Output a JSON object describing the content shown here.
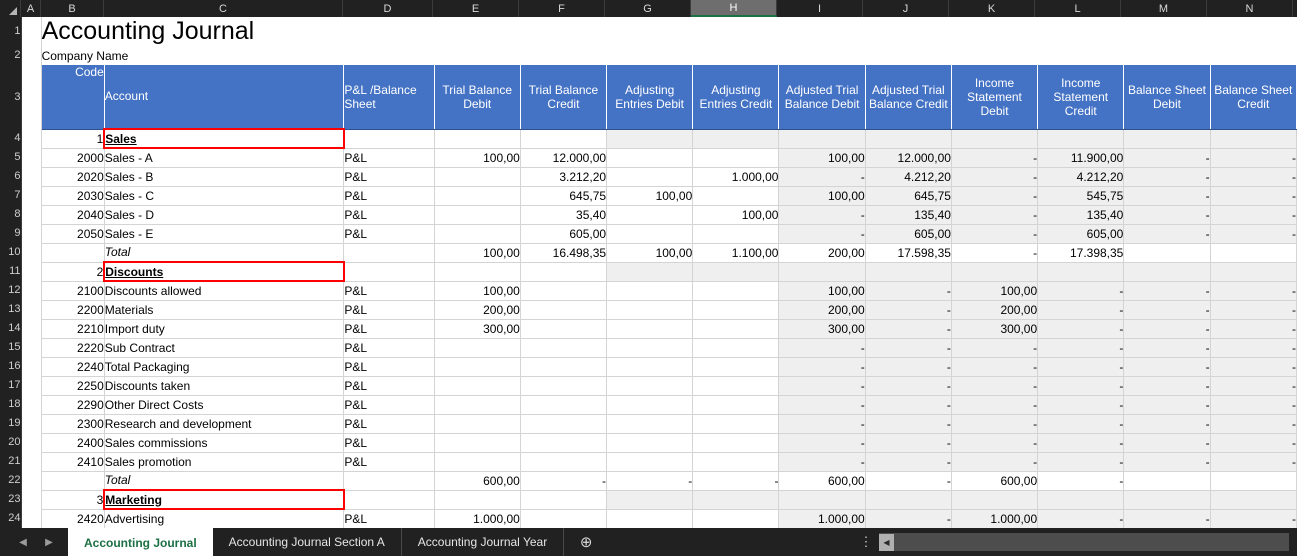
{
  "window": {
    "column_headers": [
      "A",
      "B",
      "C",
      "D",
      "E",
      "F",
      "G",
      "H",
      "I",
      "J",
      "K",
      "L",
      "M",
      "N"
    ],
    "selected_column": "H"
  },
  "document": {
    "title": "Accounting Journal",
    "subtitle": "Company Name"
  },
  "table": {
    "headers": {
      "code": "Code",
      "account": "Account",
      "pl_balance_sheet": "P&L /Balance Sheet",
      "trial_balance_debit": "Trial Balance Debit",
      "trial_balance_credit": "Trial Balance Credit",
      "adjusting_entries_debit": "Adjusting Entries Debit",
      "adjusting_entries_credit": "Adjusting Entries Credit",
      "adjusted_trial_balance_debit": "Adjusted Trial Balance Debit",
      "adjusted_trial_balance_credit": "Adjusted Trial Balance Credit",
      "income_statement_debit": "Income Statement Debit",
      "income_statement_credit": "Income Statement Credit",
      "balance_sheet_debit": "Balance Sheet Debit",
      "balance_sheet_credit": "Balance Sheet Credit"
    },
    "total_label": "Total",
    "rows": [
      {
        "rownum": "4",
        "kind": "section",
        "code": "1",
        "account": "Sales"
      },
      {
        "rownum": "5",
        "kind": "data",
        "code": "2000",
        "account": "Sales - A",
        "pl": "P&L",
        "tbd": "100,00",
        "tbc": "12.000,00",
        "aed": "",
        "aec": "",
        "atbd": "100,00",
        "atbc": "12.000,00",
        "isd": "-",
        "isc": "11.900,00",
        "bsd": "-",
        "bsc": "-"
      },
      {
        "rownum": "6",
        "kind": "data",
        "code": "2020",
        "account": "Sales - B",
        "pl": "P&L",
        "tbd": "",
        "tbc": "3.212,20",
        "aed": "",
        "aec": "1.000,00",
        "atbd": "-",
        "atbc": "4.212,20",
        "isd": "-",
        "isc": "4.212,20",
        "bsd": "-",
        "bsc": "-"
      },
      {
        "rownum": "7",
        "kind": "data",
        "code": "2030",
        "account": "Sales - C",
        "pl": "P&L",
        "tbd": "",
        "tbc": "645,75",
        "aed": "100,00",
        "aec": "",
        "atbd": "100,00",
        "atbc": "645,75",
        "isd": "-",
        "isc": "545,75",
        "bsd": "-",
        "bsc": "-"
      },
      {
        "rownum": "8",
        "kind": "data",
        "code": "2040",
        "account": "Sales - D",
        "pl": "P&L",
        "tbd": "",
        "tbc": "35,40",
        "aed": "",
        "aec": "100,00",
        "atbd": "-",
        "atbc": "135,40",
        "isd": "-",
        "isc": "135,40",
        "bsd": "-",
        "bsc": "-"
      },
      {
        "rownum": "9",
        "kind": "data",
        "code": "2050",
        "account": "Sales - E",
        "pl": "P&L",
        "tbd": "",
        "tbc": "605,00",
        "aed": "",
        "aec": "",
        "atbd": "-",
        "atbc": "605,00",
        "isd": "-",
        "isc": "605,00",
        "bsd": "-",
        "bsc": "-"
      },
      {
        "rownum": "10",
        "kind": "total",
        "code": "",
        "account": "Total",
        "pl": "",
        "tbd": "100,00",
        "tbc": "16.498,35",
        "aed": "100,00",
        "aec": "1.100,00",
        "atbd": "200,00",
        "atbc": "17.598,35",
        "isd": "-",
        "isc": "17.398,35",
        "bsd": "",
        "bsc": ""
      },
      {
        "rownum": "11",
        "kind": "section",
        "code": "2",
        "account": "Discounts"
      },
      {
        "rownum": "12",
        "kind": "data",
        "code": "2100",
        "account": "Discounts allowed",
        "pl": "P&L",
        "tbd": "100,00",
        "tbc": "",
        "aed": "",
        "aec": "",
        "atbd": "100,00",
        "atbc": "-",
        "isd": "100,00",
        "isc": "-",
        "bsd": "-",
        "bsc": "-"
      },
      {
        "rownum": "13",
        "kind": "data",
        "code": "2200",
        "account": "Materials",
        "pl": "P&L",
        "tbd": "200,00",
        "tbc": "",
        "aed": "",
        "aec": "",
        "atbd": "200,00",
        "atbc": "-",
        "isd": "200,00",
        "isc": "-",
        "bsd": "-",
        "bsc": "-"
      },
      {
        "rownum": "14",
        "kind": "data",
        "code": "2210",
        "account": "Import duty",
        "pl": "P&L",
        "tbd": "300,00",
        "tbc": "",
        "aed": "",
        "aec": "",
        "atbd": "300,00",
        "atbc": "-",
        "isd": "300,00",
        "isc": "-",
        "bsd": "-",
        "bsc": "-"
      },
      {
        "rownum": "15",
        "kind": "data",
        "code": "2220",
        "account": "Sub Contract",
        "pl": "P&L",
        "tbd": "",
        "tbc": "",
        "aed": "",
        "aec": "",
        "atbd": "-",
        "atbc": "-",
        "isd": "-",
        "isc": "-",
        "bsd": "-",
        "bsc": "-"
      },
      {
        "rownum": "16",
        "kind": "data",
        "code": "2240",
        "account": "Total Packaging",
        "pl": "P&L",
        "tbd": "",
        "tbc": "",
        "aed": "",
        "aec": "",
        "atbd": "-",
        "atbc": "-",
        "isd": "-",
        "isc": "-",
        "bsd": "-",
        "bsc": "-"
      },
      {
        "rownum": "17",
        "kind": "data",
        "code": "2250",
        "account": "Discounts taken",
        "pl": "P&L",
        "tbd": "",
        "tbc": "",
        "aed": "",
        "aec": "",
        "atbd": "-",
        "atbc": "-",
        "isd": "-",
        "isc": "-",
        "bsd": "-",
        "bsc": "-"
      },
      {
        "rownum": "18",
        "kind": "data",
        "code": "2290",
        "account": "Other Direct Costs",
        "pl": "P&L",
        "tbd": "",
        "tbc": "",
        "aed": "",
        "aec": "",
        "atbd": "-",
        "atbc": "-",
        "isd": "-",
        "isc": "-",
        "bsd": "-",
        "bsc": "-"
      },
      {
        "rownum": "19",
        "kind": "data",
        "code": "2300",
        "account": "Research and development",
        "pl": "P&L",
        "tbd": "",
        "tbc": "",
        "aed": "",
        "aec": "",
        "atbd": "-",
        "atbc": "-",
        "isd": "-",
        "isc": "-",
        "bsd": "-",
        "bsc": "-"
      },
      {
        "rownum": "20",
        "kind": "data",
        "code": "2400",
        "account": "Sales commissions",
        "pl": "P&L",
        "tbd": "",
        "tbc": "",
        "aed": "",
        "aec": "",
        "atbd": "-",
        "atbc": "-",
        "isd": "-",
        "isc": "-",
        "bsd": "-",
        "bsc": "-"
      },
      {
        "rownum": "21",
        "kind": "data",
        "code": "2410",
        "account": "Sales promotion",
        "pl": "P&L",
        "tbd": "",
        "tbc": "",
        "aed": "",
        "aec": "",
        "atbd": "-",
        "atbc": "-",
        "isd": "-",
        "isc": "-",
        "bsd": "-",
        "bsc": "-"
      },
      {
        "rownum": "22",
        "kind": "total",
        "code": "",
        "account": "Total",
        "pl": "",
        "tbd": "600,00",
        "tbc": "-",
        "aed": "-",
        "aec": "-",
        "atbd": "600,00",
        "atbc": "-",
        "isd": "600,00",
        "isc": "-",
        "bsd": "",
        "bsc": ""
      },
      {
        "rownum": "23",
        "kind": "section",
        "code": "3",
        "account": "Marketing"
      },
      {
        "rownum": "24",
        "kind": "data",
        "code": "2420",
        "account": "Advertising",
        "pl": "P&L",
        "tbd": "1.000,00",
        "tbc": "",
        "aed": "",
        "aec": "",
        "atbd": "1.000,00",
        "atbc": "-",
        "isd": "1.000,00",
        "isc": "-",
        "bsd": "-",
        "bsc": "-"
      }
    ]
  },
  "sheet_bar": {
    "prev_arrow": "◀",
    "next_arrow": "▶",
    "tabs": [
      {
        "label": "Accounting Journal",
        "active": true
      },
      {
        "label": "Accounting Journal Section A",
        "active": false
      },
      {
        "label": "Accounting Journal Year",
        "active": false
      }
    ],
    "add_sheet": "⊕",
    "options_icon": "⋮",
    "hscroll_left": "◀"
  },
  "colors": {
    "header_blue": "#4472c4",
    "section_box_red": "#ff0000",
    "active_tab_green": "#1d7044",
    "shaded_cell": "#efefef",
    "chrome_dark": "#212121"
  }
}
